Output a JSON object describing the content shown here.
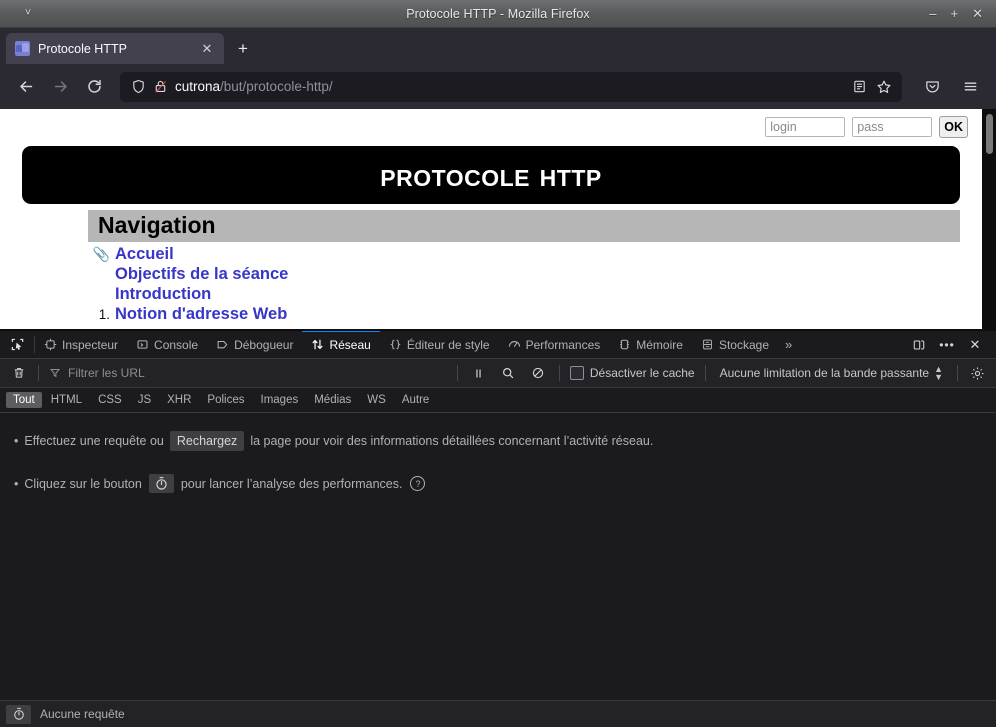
{
  "window": {
    "title": "Protocole HTTP - Mozilla Firefox",
    "menu_chevron": "˅",
    "minimize": "–",
    "maximize": "+",
    "close": "✕"
  },
  "tabs": {
    "items": [
      {
        "label": "Protocole HTTP",
        "close": "✕",
        "favicon": "site-favicon"
      }
    ],
    "new_tab": "+"
  },
  "navbar": {
    "back": "←",
    "forward": "→",
    "reload": "↻",
    "url_domain": "cutrona",
    "url_path": "/but/protocole-http/",
    "shield_icon": "tracking-protection-shield",
    "lock_icon": "insecure-connection-lock",
    "reader_icon": "reader-mode",
    "bookmark_icon": "bookmark-star",
    "pocket_icon": "save-to-pocket",
    "menu_icon": "application-menu"
  },
  "page": {
    "login": {
      "login_placeholder": "login",
      "pass_placeholder": "pass",
      "ok_label": "OK"
    },
    "banner_title": "Protocole HTTP",
    "nav_heading": "Navigation",
    "nav_items": [
      {
        "mark": "📎",
        "mark_type": "clip",
        "label": "Accueil"
      },
      {
        "mark": "",
        "mark_type": "none",
        "label": "Objectifs de la séance"
      },
      {
        "mark": "",
        "mark_type": "none",
        "label": "Introduction"
      },
      {
        "mark": "1.",
        "mark_type": "number",
        "label": "Notion d'adresse Web"
      }
    ]
  },
  "devtools": {
    "picker_icon": "element-picker",
    "tabs": [
      {
        "label": "Inspecteur",
        "icon": "inspector-icon",
        "active": false
      },
      {
        "label": "Console",
        "icon": "console-icon",
        "active": false
      },
      {
        "label": "Débogueur",
        "icon": "debugger-icon",
        "active": false
      },
      {
        "label": "Réseau",
        "icon": "network-icon",
        "active": true
      },
      {
        "label": "Éditeur de style",
        "icon": "style-editor-icon",
        "active": false
      },
      {
        "label": "Performances",
        "icon": "performance-icon",
        "active": false
      },
      {
        "label": "Mémoire",
        "icon": "memory-icon",
        "active": false
      },
      {
        "label": "Stockage",
        "icon": "storage-icon",
        "active": false
      }
    ],
    "overflow": "»",
    "dock_icon": "dock-to-side",
    "meatball": "•••",
    "close": "✕",
    "filterbar": {
      "clear_icon": "trash-icon",
      "filter_placeholder": "Filtrer les URL",
      "filter_icon": "funnel-icon",
      "pause_icon": "pause-icon",
      "search_icon": "search-icon",
      "block_icon": "block-icon",
      "disable_cache_label": "Désactiver le cache",
      "disable_cache_checked": false,
      "throttle_value": "Aucune limitation de la bande passante",
      "settings_icon": "gear-icon"
    },
    "type_filters": [
      {
        "label": "Tout",
        "active": true
      },
      {
        "label": "HTML",
        "active": false
      },
      {
        "label": "CSS",
        "active": false
      },
      {
        "label": "JS",
        "active": false
      },
      {
        "label": "XHR",
        "active": false
      },
      {
        "label": "Polices",
        "active": false
      },
      {
        "label": "Images",
        "active": false
      },
      {
        "label": "Médias",
        "active": false
      },
      {
        "label": "WS",
        "active": false
      },
      {
        "label": "Autre",
        "active": false
      }
    ],
    "empty_state": {
      "bullet": "•",
      "hint1_pre": "Effectuez une requête ou",
      "hint1_button": "Rechargez",
      "hint1_post": "la page pour voir des informations détaillées concernant l’activité réseau.",
      "hint2_pre": "Cliquez sur le bouton",
      "hint2_icon": "stopwatch-icon",
      "hint2_post": "pour lancer l’analyse des performances.",
      "help": "?"
    },
    "status": {
      "icon": "stopwatch-icon",
      "text": "Aucune requête"
    }
  },
  "colors": {
    "accent": "#0a84ff",
    "link": "#3836c8",
    "devtools_bg": "#1b1b1d",
    "chrome_bg": "#2b2a33"
  }
}
